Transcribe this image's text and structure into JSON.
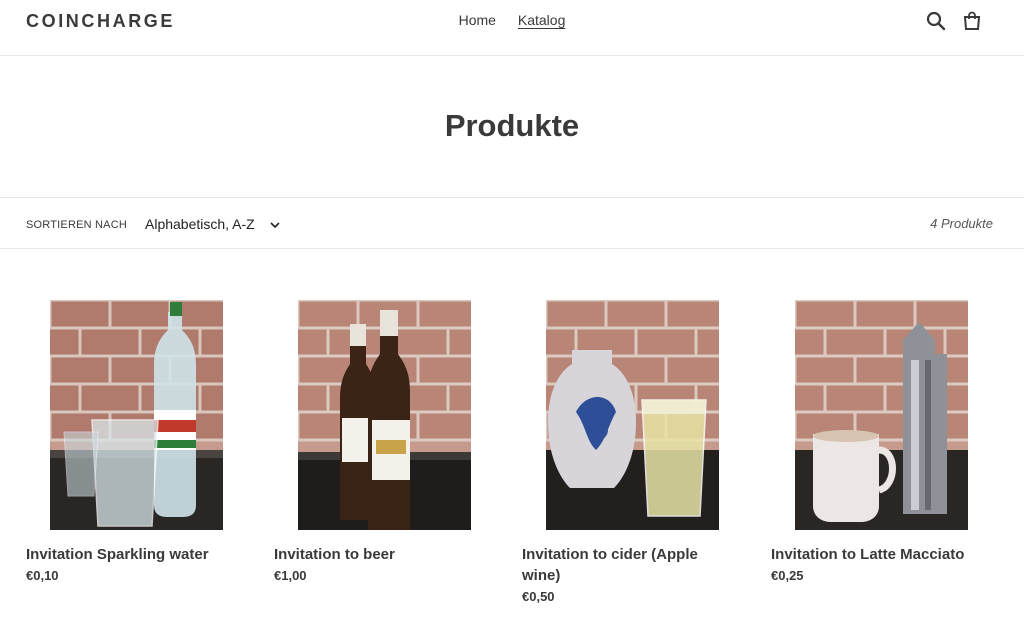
{
  "header": {
    "logo": "COINCHARGE",
    "nav": [
      {
        "label": "Home",
        "active": false
      },
      {
        "label": "Katalog",
        "active": true
      }
    ],
    "icons": [
      "search-icon",
      "cart-icon"
    ]
  },
  "page": {
    "title": "Produkte"
  },
  "filter": {
    "sort_label": "SORTIEREN NACH",
    "sort_value": "Alphabetisch, A-Z",
    "count": "4 Produkte"
  },
  "products": [
    {
      "name": "Invitation Sparkling water",
      "price": "€0,10",
      "image": "sparkling-water-photo"
    },
    {
      "name": "Invitation to beer",
      "price": "€1,00",
      "image": "beer-photo"
    },
    {
      "name": "Invitation to cider (Apple wine)",
      "price": "€0,50",
      "image": "cider-photo"
    },
    {
      "name": "Invitation to Latte Macciato",
      "price": "€0,25",
      "image": "latte-macchiato-photo"
    }
  ],
  "colors": {
    "text": "#3a3a3a",
    "border": "#e8e8e8",
    "brick": "#b8857a"
  }
}
